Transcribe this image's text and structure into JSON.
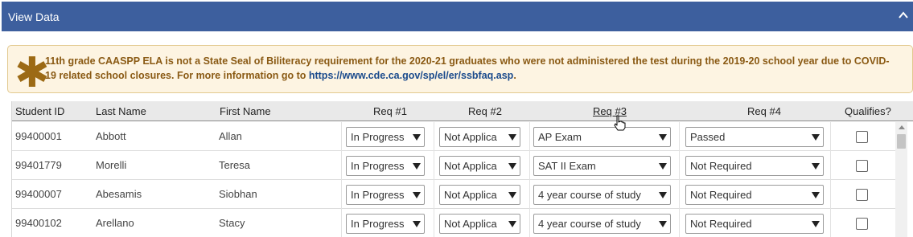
{
  "panel": {
    "title": "View Data"
  },
  "notice": {
    "text": "11th grade CAASPP ELA is not a State Seal of Biliteracy requirement for the 2020-21 graduates who were not administered the test during the 2019-20 school year due to COVID-19 related school closures. For more information go to ",
    "link": "https://www.cde.ca.gov/sp/el/er/ssbfaq.asp",
    "suffix": "."
  },
  "table": {
    "columns": [
      "Student ID",
      "Last Name",
      "First Name",
      "Req #1",
      "Req #2",
      "Req #3",
      "Req #4",
      "Qualifies?"
    ],
    "rows": [
      {
        "id": "99400001",
        "last": "Abbott",
        "first": "Allan",
        "req1": "In Progress",
        "req2": "Not Applica",
        "req3": "AP Exam",
        "req4": "Passed"
      },
      {
        "id": "99401779",
        "last": "Morelli",
        "first": "Teresa",
        "req1": "In Progress",
        "req2": "Not Applica",
        "req3": "SAT II Exam",
        "req4": "Not Required"
      },
      {
        "id": "99400007",
        "last": "Abesamis",
        "first": "Siobhan",
        "req1": "In Progress",
        "req2": "Not Applica",
        "req3": "4 year course of study",
        "req4": "Not Required"
      },
      {
        "id": "99400102",
        "last": "Arellano",
        "first": "Stacy",
        "req1": "In Progress",
        "req2": "Not Applica",
        "req3": "4 year course of study",
        "req4": "Not Required"
      }
    ]
  },
  "colors": {
    "header_bg": "#3d5f9e",
    "notice_bg": "#fdf4e2",
    "notice_text": "#8a5a14",
    "link": "#1a4a8c"
  },
  "icons": [
    "chevron-up-icon",
    "asterisk-icon",
    "dropdown-arrow-icon",
    "checkbox-icon",
    "hand-cursor-icon"
  ]
}
